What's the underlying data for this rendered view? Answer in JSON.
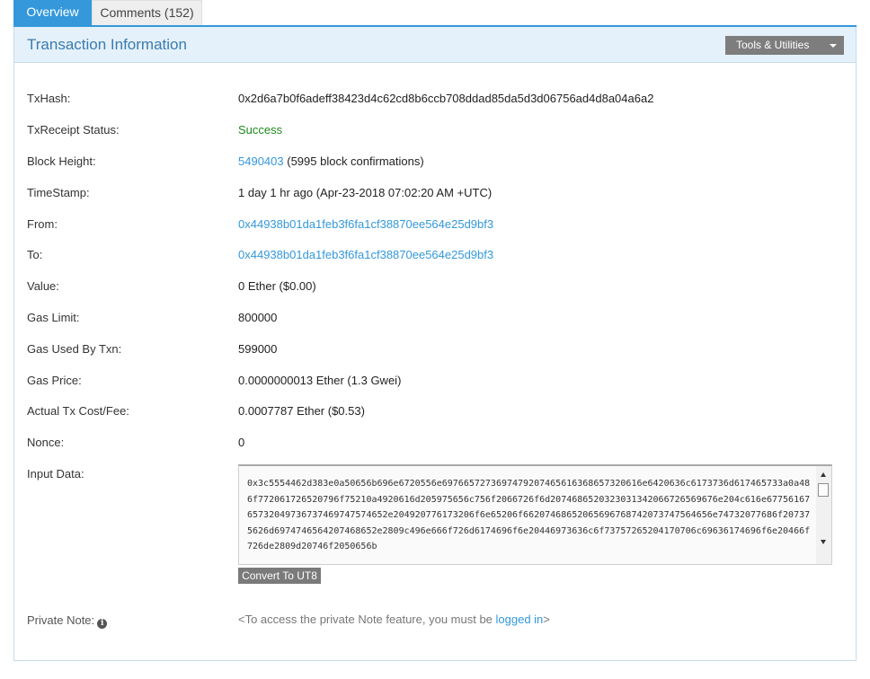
{
  "tabs": {
    "overview": "Overview",
    "comments": "Comments (152)"
  },
  "panel": {
    "title": "Transaction Information",
    "tools_label": "Tools & Utilities"
  },
  "fields": {
    "txhash": {
      "label": "TxHash:",
      "value": "0x2d6a7b0f6adeff38423d4c62cd8b6ccb708ddad85da5d3d06756ad4d8a04a6a2"
    },
    "status": {
      "label": "TxReceipt Status:",
      "value": "Success"
    },
    "block": {
      "label": "Block Height:",
      "link": "5490403",
      "suffix": " (5995 block confirmations)"
    },
    "timestamp": {
      "label": "TimeStamp:",
      "value": "1 day 1 hr ago (Apr-23-2018 07:02:20 AM +UTC)"
    },
    "from": {
      "label": "From:",
      "value": "0x44938b01da1feb3f6fa1cf38870ee564e25d9bf3"
    },
    "to": {
      "label": "To:",
      "value": "0x44938b01da1feb3f6fa1cf38870ee564e25d9bf3"
    },
    "value": {
      "label": "Value:",
      "value": "0 Ether ($0.00)"
    },
    "gas_limit": {
      "label": "Gas Limit:",
      "value": "800000"
    },
    "gas_used": {
      "label": "Gas Used By Txn:",
      "value": "599000"
    },
    "gas_price": {
      "label": "Gas Price:",
      "value": "0.0000000013 Ether (1.3 Gwei)"
    },
    "fee": {
      "label": "Actual Tx Cost/Fee:",
      "value": "0.0007787 Ether ($0.53)"
    },
    "nonce": {
      "label": "Nonce:",
      "value": "0"
    },
    "input": {
      "label": "Input Data:",
      "value": "0x3c5554462d383e0a50656b696e6720556e6976657273697479207465616368657320616e6420636c6173736d617465733a0a486f772061726520796f75210a4920616d205975656c756f2066726f6d2074686520323031342066726569676e204c616e6775616765732049736737469747574652e204920776173206f6e65206f66207468652065696768742073747564656e74732077686f207375626d6974746564207468652e2809c496e666f726d6174696f6e20446973636c6f73757265204170706c69636174696f6e20466f726de2809d20746f2050656b",
      "convert_label": "Convert To UT8"
    },
    "note": {
      "label": "Private Note:",
      "prefix": "<To access the private Note feature, you must be ",
      "link": "logged in",
      "suffix": ">"
    }
  }
}
